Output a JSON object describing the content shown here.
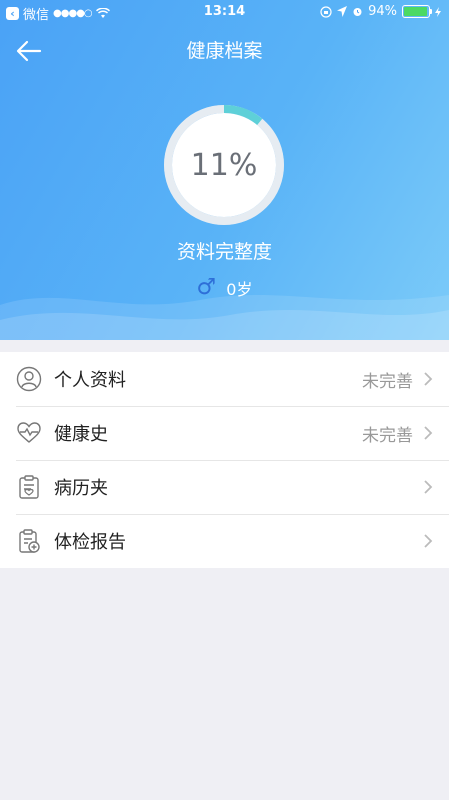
{
  "status_bar": {
    "carrier": "微信",
    "signal": "●●●●○",
    "time": "13:14",
    "battery": "94%",
    "battery_level": 0.94
  },
  "nav": {
    "title": "健康档案"
  },
  "profile": {
    "completeness": "11%",
    "completeness_value": 0.11,
    "completeness_label": "资料完整度",
    "gender_symbol": "♂",
    "age": "0岁"
  },
  "menu": [
    {
      "label": "个人资料",
      "status": "未完善",
      "icon": "person-icon"
    },
    {
      "label": "健康史",
      "status": "未完善",
      "icon": "heart-pulse-icon"
    },
    {
      "label": "病历夹",
      "status": "",
      "icon": "clipboard-icon"
    },
    {
      "label": "体检报告",
      "status": "",
      "icon": "report-add-icon"
    }
  ],
  "colors": {
    "header_start": "#4aa2f6",
    "header_end": "#7ccbf9",
    "ring_progress": "#5ed0d8",
    "male": "#2e6fd8",
    "background": "#efeff4"
  }
}
